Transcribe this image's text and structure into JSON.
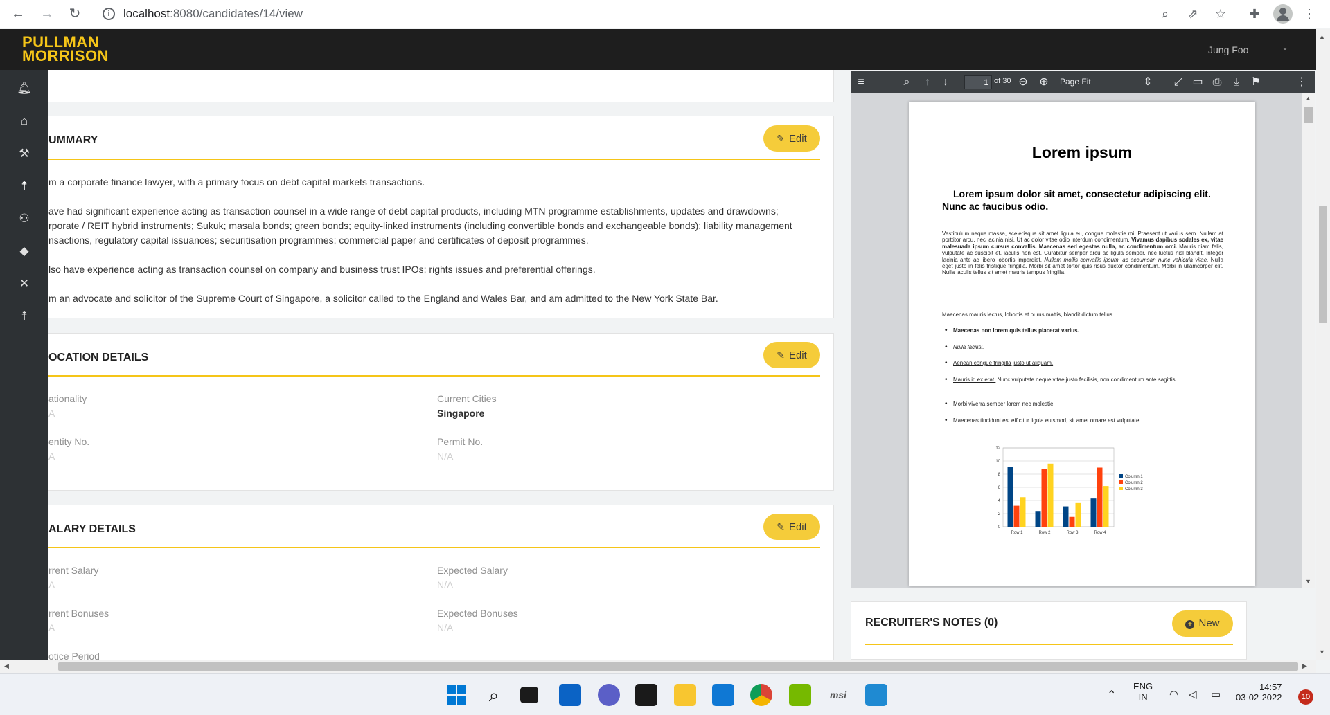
{
  "browser": {
    "url_host": "localhost",
    "url_path": ":8080/candidates/14/view"
  },
  "app": {
    "logo_line1": "PULLMAN",
    "logo_line2": "MORRISON",
    "user_name": "Jung Foo"
  },
  "summary": {
    "title": "UMMARY",
    "edit_label": "Edit",
    "paragraphs": [
      "m a corporate finance lawyer, with a primary focus on debt capital markets transactions.",
      "ave had significant experience acting as transaction counsel in a wide range of debt capital products, including MTN programme establishments, updates and drawdowns;",
      "rporate / REIT hybrid instruments; Sukuk; masala bonds; green bonds; equity-linked instruments (including convertible bonds and exchangeable bonds); liability management",
      "nsactions, regulatory capital issuances; securitisation programmes; commercial paper and certificates of deposit programmes.",
      "lso have experience acting as transaction counsel on company and business trust IPOs; rights issues and preferential offerings.",
      "m an advocate and solicitor of the Supreme Court of Singapore, a solicitor called to the England and Wales Bar, and am admitted to the New York State Bar."
    ]
  },
  "location": {
    "title": "OCATION DETAILS",
    "edit_label": "Edit",
    "nationality_label": "ationality",
    "nationality_value": "A",
    "current_cities_label": "Current Cities",
    "current_cities_value": "Singapore",
    "identity_label": "entity No.",
    "identity_value": "A",
    "permit_label": "Permit No.",
    "permit_value": "N/A"
  },
  "salary": {
    "title": "ALARY DETAILS",
    "edit_label": "Edit",
    "current_salary_label": "rrent Salary",
    "current_salary_value": "A",
    "expected_salary_label": "Expected Salary",
    "expected_salary_value": "N/A",
    "current_bonuses_label": "rrent Bonuses",
    "current_bonuses_value": "A",
    "expected_bonuses_label": "Expected Bonuses",
    "expected_bonuses_value": "N/A",
    "notice_label": "otice Period"
  },
  "pdf_viewer": {
    "page_number": "1",
    "page_count_label": "of 30",
    "zoom_label": "Page Fit",
    "doc_title": "Lorem ipsum",
    "doc_subtitle": "Lorem ipsum dolor sit amet, consectetur adipiscing elit. Nunc ac faucibus odio.",
    "body_text_a": "Vestibulum neque massa, scelerisque sit amet ligula eu, congue molestie mi. Praesent ut varius sem. Nullam at porttitor arcu, nec lacinia nisi. Ut ac dolor vitae odio interdum condimentum. ",
    "body_text_bold": "Vivamus dapibus sodales ex, vitae malesuada ipsum cursus convallis. Maecenas sed egestas nulla, ac condimentum orci.",
    "body_text_b": " Mauris diam felis, vulputate ac suscipit et, iaculis non est. Curabitur semper arcu ac ligula semper, nec luctus nisl blandit. Integer lacinia ante ac libero lobortis imperdiet. ",
    "body_text_italic": "Nullam mollis convallis ipsum, ac accumsan nunc vehicula vitae.",
    "body_text_c": " Nulla eget justo in felis tristique fringilla. Morbi sit amet tortor quis risus auctor condimentum. Morbi in ullamcorper elit. Nulla iaculis tellus sit amet mauris tempus fringilla.",
    "para2": "Maecenas mauris lectus, lobortis et purus mattis, blandit dictum tellus.",
    "list": [
      "Maecenas non lorem quis tellus placerat varius.",
      "Nulla facilisi.",
      "Aenean congue fringilla justo ut aliquam.",
      "Mauris id ex erat.",
      " Nunc vulputate neque vitae justo facilisis, non condimentum ante sagittis.",
      "Morbi viverra semper lorem nec molestie.",
      "Maecenas tincidunt est efficitur ligula euismod, sit amet ornare est vulputate."
    ]
  },
  "chart_data": {
    "type": "bar",
    "categories": [
      "Row 1",
      "Row 2",
      "Row 3",
      "Row 4"
    ],
    "series": [
      {
        "name": "Column 1",
        "values": [
          9.1,
          2.4,
          3.1,
          4.3
        ],
        "color": "#004586"
      },
      {
        "name": "Column 2",
        "values": [
          3.2,
          8.8,
          1.5,
          9.0
        ],
        "color": "#ff420e"
      },
      {
        "name": "Column 3",
        "values": [
          4.5,
          9.6,
          3.7,
          6.2
        ],
        "color": "#ffd320"
      }
    ],
    "yticks": [
      "0",
      "2",
      "4",
      "6",
      "8",
      "10",
      "12"
    ],
    "ylim": [
      0,
      12
    ],
    "grid": true,
    "legend": "right"
  },
  "notes": {
    "title": "RECRUITER'S NOTES (0)",
    "new_label": "New"
  },
  "taskbar": {
    "lang_line1": "ENG",
    "lang_line2": "IN",
    "time": "14:57",
    "date": "03-02-2022",
    "notif_count": "10",
    "msi_label": "msi"
  },
  "colors": {
    "accent": "#f5c518",
    "header_bg": "#1e1e1e",
    "sidebar_bg": "#2d3134"
  }
}
